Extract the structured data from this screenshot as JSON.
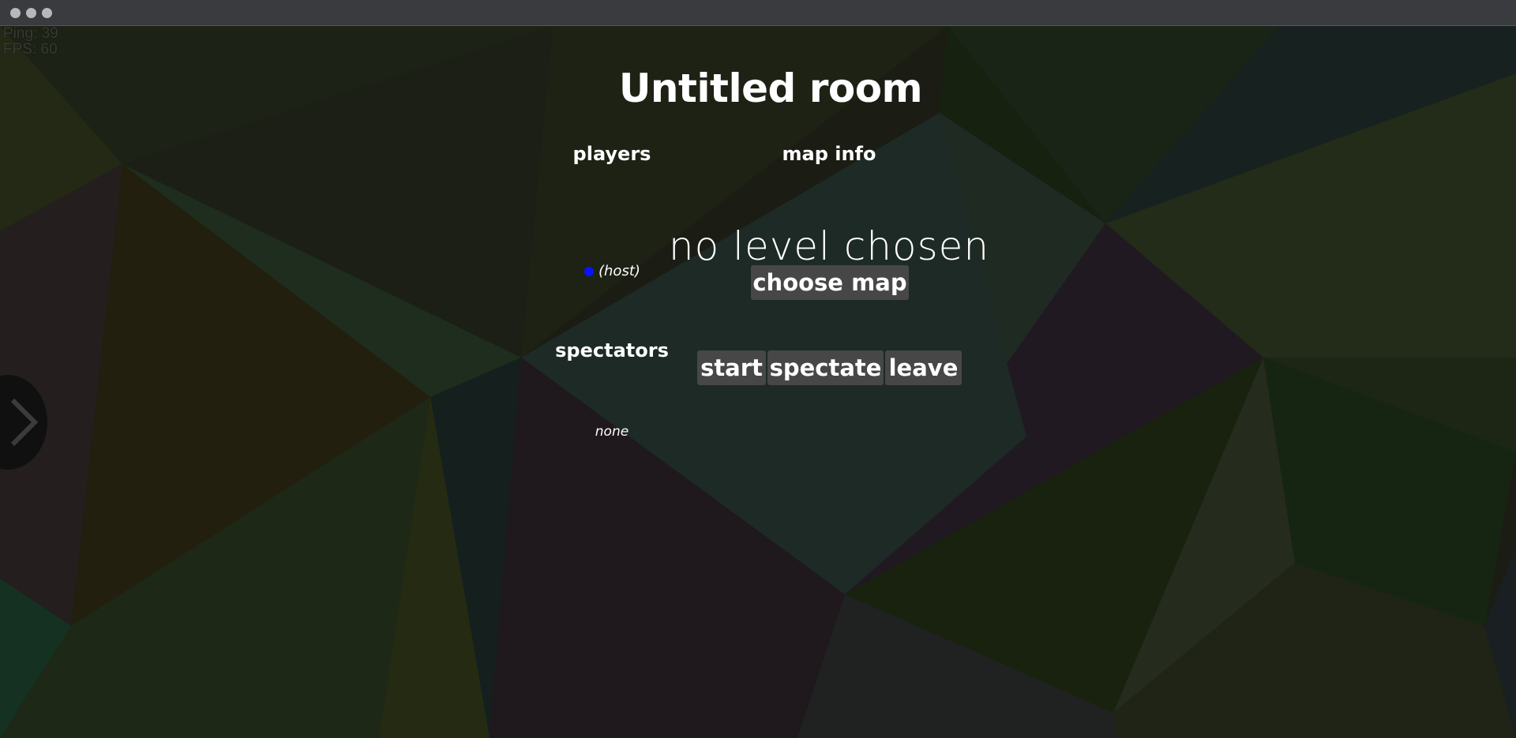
{
  "hud": {
    "ping": "Ping: 39",
    "fps": "FPS: 60"
  },
  "room": {
    "title": "Untitled room"
  },
  "players": {
    "heading": "players",
    "host_label": "(host)"
  },
  "map_info": {
    "heading": "map info",
    "status": "no level chosen",
    "choose_label": "choose map"
  },
  "spectators": {
    "heading": "spectators",
    "empty_label": "none"
  },
  "actions": {
    "start_label": "start",
    "spectate_label": "spectate",
    "leave_label": "leave"
  },
  "colors": {
    "host_dot": "#0a13ff",
    "button_bg": "#474747"
  },
  "icons": {
    "side_tab": "chevron-right-icon"
  }
}
